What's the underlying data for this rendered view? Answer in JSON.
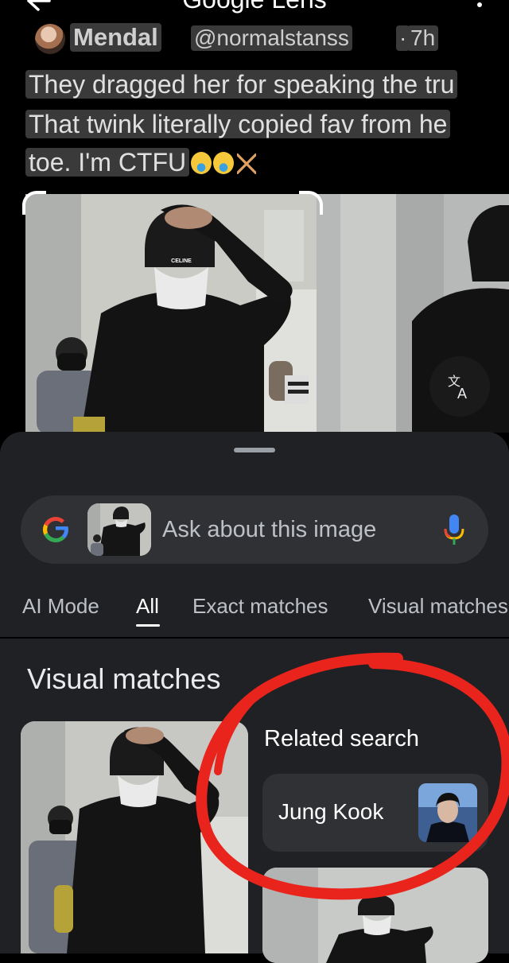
{
  "app": {
    "title": "Google Lens"
  },
  "tweet": {
    "author_name": "Mendal",
    "author_handle": "@normalstanss",
    "separator": "·",
    "time": "7h",
    "lines": [
      "They dragged her for speaking the tru",
      "That twink literally copied fav from he",
      "toe. I'm CTFU"
    ],
    "photo_text": "CELINE"
  },
  "search": {
    "placeholder": "Ask about this image"
  },
  "tabs": [
    {
      "label": "AI Mode"
    },
    {
      "label": "All",
      "active": true
    },
    {
      "label": "Exact matches"
    },
    {
      "label": "Visual matches"
    }
  ],
  "results": {
    "section_title": "Visual matches",
    "related_title": "Related search",
    "related_item": "Jung Kook"
  },
  "colors": {
    "sheet_bg": "#202124",
    "searchbar_bg": "#303134",
    "annotation_red": "#e8241c"
  },
  "icons": [
    "back-arrow-icon",
    "more-vert-icon",
    "translate-icon",
    "google-g-icon",
    "mic-icon"
  ]
}
